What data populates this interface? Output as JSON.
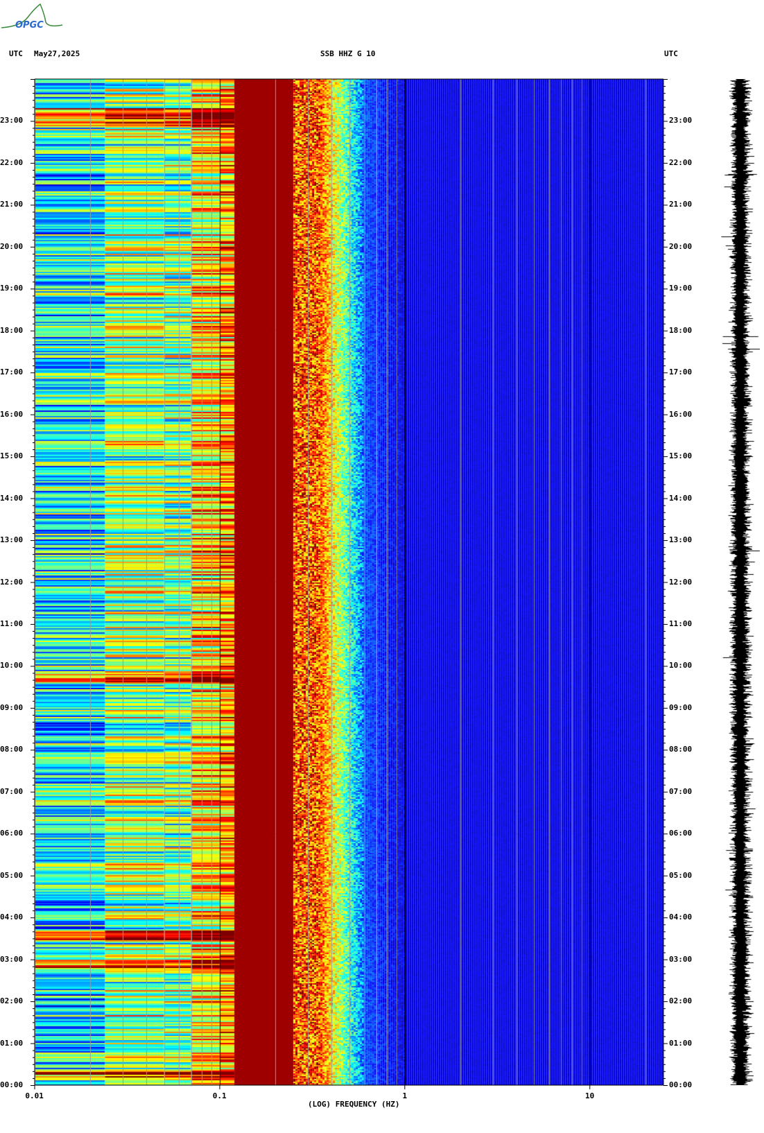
{
  "logo": {
    "text": "OPGC"
  },
  "header": {
    "left_label": "UTC",
    "date": "May27,2025",
    "title": "SSB HHZ G 10",
    "right_label": "UTC"
  },
  "chart_data": {
    "type": "heatmap",
    "title": "SSB HHZ G 10",
    "xlabel": "(LOG) FREQUENCY (HZ)",
    "ylabel": "UTC",
    "x_scale": "log",
    "xlim": [
      0.01,
      25
    ],
    "x_ticks": [
      {
        "value": 0.01,
        "label": "0.01"
      },
      {
        "value": 0.1,
        "label": "0.1"
      },
      {
        "value": 1,
        "label": "1"
      },
      {
        "value": 10,
        "label": "10"
      }
    ],
    "ylim_hours": [
      0,
      24
    ],
    "y_ticks": [
      "00:00",
      "01:00",
      "02:00",
      "03:00",
      "04:00",
      "05:00",
      "06:00",
      "07:00",
      "08:00",
      "09:00",
      "10:00",
      "11:00",
      "12:00",
      "13:00",
      "14:00",
      "15:00",
      "16:00",
      "17:00",
      "18:00",
      "19:00",
      "20:00",
      "21:00",
      "22:00",
      "23:00"
    ],
    "minor_tick_minutes": 10,
    "colormap": "jet",
    "grid": "vertical lines at 1-9 x each decade",
    "bands": [
      {
        "f_range": [
          0.01,
          0.024
        ],
        "level": 0.38
      },
      {
        "f_range": [
          0.024,
          0.05
        ],
        "level": 0.52
      },
      {
        "f_range": [
          0.05,
          0.07
        ],
        "level": 0.5
      },
      {
        "f_range": [
          0.07,
          0.1
        ],
        "level": 0.66
      },
      {
        "f_range": [
          0.1,
          0.12
        ],
        "level": 0.72
      },
      {
        "f_range": [
          0.12,
          0.25
        ],
        "level": 1.0
      },
      {
        "f_range": [
          0.25,
          0.35
        ],
        "level": 0.85
      },
      {
        "f_range": [
          0.35,
          0.6
        ],
        "level": 0.45
      },
      {
        "f_range": [
          0.6,
          25
        ],
        "level": 0.08
      }
    ],
    "events_hours": [
      0.25,
      2.9,
      3.6,
      23.0,
      23.2,
      9.7
    ],
    "side_panel": "seismogram trace"
  }
}
